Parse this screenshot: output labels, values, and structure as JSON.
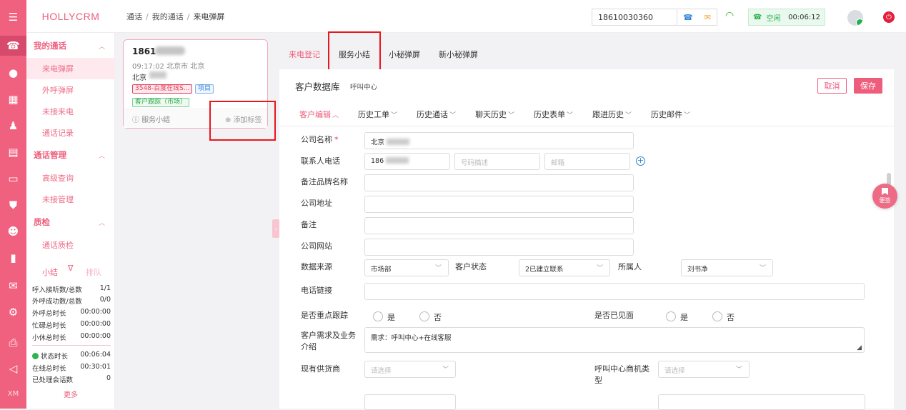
{
  "brand": {
    "name": "HOLLYCRM",
    "accent": "#ee5d7b",
    "rail_color": "#f0617f"
  },
  "breadcrumb": [
    "通话",
    "我的通话",
    "来电弹屏"
  ],
  "topbar": {
    "phone": "18610030360",
    "status": "空闲",
    "timer": "00:06:12",
    "icons": [
      "phone-icon",
      "chat-icon",
      "wifi-icon",
      "power-icon"
    ]
  },
  "rail": {
    "bottom_label": "XM"
  },
  "sidebar": {
    "groups": [
      {
        "label": "我的通话",
        "items": [
          "来电弹屏",
          "外呼弹屏",
          "未接来电",
          "通话记录"
        ]
      },
      {
        "label": "通话管理",
        "items": [
          "高级查询",
          "未接管理"
        ]
      },
      {
        "label": "质检",
        "items": [
          "通话质检"
        ]
      }
    ],
    "active_item": "来电弹屏"
  },
  "stats": {
    "tabs": [
      "小结",
      "排队"
    ],
    "rows": [
      {
        "label": "呼入接听数/总数",
        "value": "1/1"
      },
      {
        "label": "外呼成功数/总数",
        "value": "0/0"
      },
      {
        "label": "外呼总时长",
        "value": "00:00:00"
      },
      {
        "label": "忙碌总时长",
        "value": "00:00:00"
      },
      {
        "label": "小休总时长",
        "value": "00:00:00"
      },
      {
        "label": "状态时长",
        "value": "00:06:04"
      },
      {
        "label": "在线总时长",
        "value": "00:30:01"
      },
      {
        "label": "已处理会话数",
        "value": "0"
      }
    ],
    "more": "更多"
  },
  "call_card": {
    "number": "1861",
    "time_location": "09:17:02 北京市 北京",
    "city": "北京",
    "tags": [
      "3548-百度在线S...",
      "项目",
      "客户跟踪（市场）"
    ],
    "summary": "服务小结",
    "add_tag": "添加标签"
  },
  "tabs": [
    "来电登记",
    "服务小结",
    "小秘弹屏",
    "新小秘弹屏"
  ],
  "panel": {
    "title": "客户数据库",
    "subtitle": "呼叫中心",
    "cancel": "取消",
    "save": "保存",
    "subtabs": [
      "客户编辑",
      "历史工单",
      "历史通话",
      "聊天历史",
      "历史表单",
      "跟进历史",
      "历史邮件"
    ]
  },
  "form": {
    "company_name": {
      "label": "公司名称",
      "value": "北京"
    },
    "contact_phone": {
      "label": "联系人电话",
      "value": "186",
      "desc_placeholder": "号码描述",
      "email_placeholder": "邮箱"
    },
    "brand_note": {
      "label": "备注品牌名称"
    },
    "address": {
      "label": "公司地址"
    },
    "remark": {
      "label": "备注"
    },
    "website": {
      "label": "公司网站"
    },
    "data_source": {
      "label": "数据来源",
      "value": "市场部"
    },
    "customer_status": {
      "label": "客户状态",
      "value": "2已建立联系"
    },
    "owner": {
      "label": "所属人",
      "value": "刘书净"
    },
    "phone_link": {
      "label": "电话链接"
    },
    "key_follow": {
      "label": "是否重点跟踪",
      "yes": "是",
      "no": "否"
    },
    "met": {
      "label": "是否已见面",
      "yes": "是",
      "no": "否"
    },
    "needs": {
      "label_line1": "客户需求及业务",
      "label_line2": "介绍",
      "value": "需求：呼叫中心+在线客服"
    },
    "supplier": {
      "label": "现有供货商",
      "placeholder": "请选择"
    },
    "cc_type": {
      "label_line1": "呼叫中心商机类",
      "label_line2": "型",
      "placeholder": "请选择"
    }
  },
  "float_note": {
    "label": "便签"
  }
}
